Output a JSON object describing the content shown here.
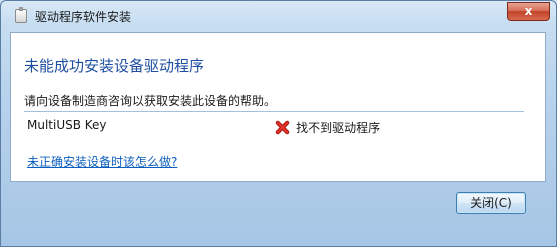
{
  "window": {
    "title": "驱动程序软件安装",
    "close_glyph": "x"
  },
  "main": {
    "heading": "未能成功安装设备驱动程序",
    "help_text": "请向设备制造商咨询以获取安装此设备的帮助。",
    "devices": [
      {
        "name": "MultiUSB Key",
        "status": "找不到驱动程序",
        "status_icon": "red-x-icon"
      }
    ],
    "help_link": "未正确安装设备时该怎么做?"
  },
  "footer": {
    "close_button_label": "关闭(C)"
  },
  "colors": {
    "heading": "#1f4fa0",
    "link": "#0b5ebd",
    "error_icon": "#d9241b"
  }
}
